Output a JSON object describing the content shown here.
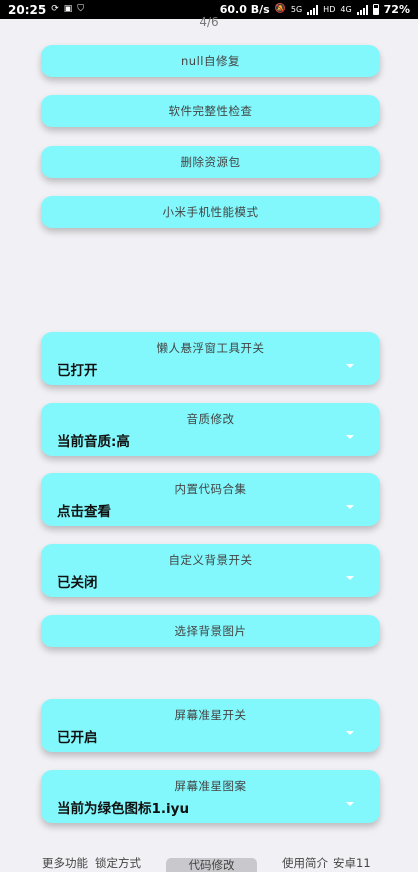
{
  "status_bar": {
    "time": "20:25",
    "net_speed": "60.0 B/s",
    "net_5g": "5G",
    "net_hd": "HD",
    "net_4g": "4G",
    "battery": "72%"
  },
  "page_indicator": "4/6",
  "top_buttons": [
    "null自修复",
    "软件完整性检查",
    "删除资源包",
    "小米手机性能模式"
  ],
  "settings": {
    "lazy_float": {
      "title": "懒人悬浮窗工具开关",
      "value": "已打开"
    },
    "audio_quality": {
      "title": "音质修改",
      "value": "当前音质:高"
    },
    "builtin_code": {
      "title": "内置代码合集",
      "value": "点击查看"
    },
    "custom_bg": {
      "title": "自定义背景开关",
      "value": "已关闭"
    },
    "choose_bg_label": "选择背景图片",
    "crosshair": {
      "title": "屏幕准星开关",
      "value": "已开启"
    },
    "crosshair_pattern": {
      "title": "屏幕准星图案",
      "value": "当前为绿色图标1.iyu"
    }
  },
  "bottom_nav": {
    "more": "更多功能",
    "lock": "锁定方式",
    "code_edit": "代码修改",
    "guide": "使用简介",
    "android": "安卓11"
  },
  "colors": {
    "card_bg": "#82f8fc",
    "page_bg": "#f1f1f5"
  }
}
